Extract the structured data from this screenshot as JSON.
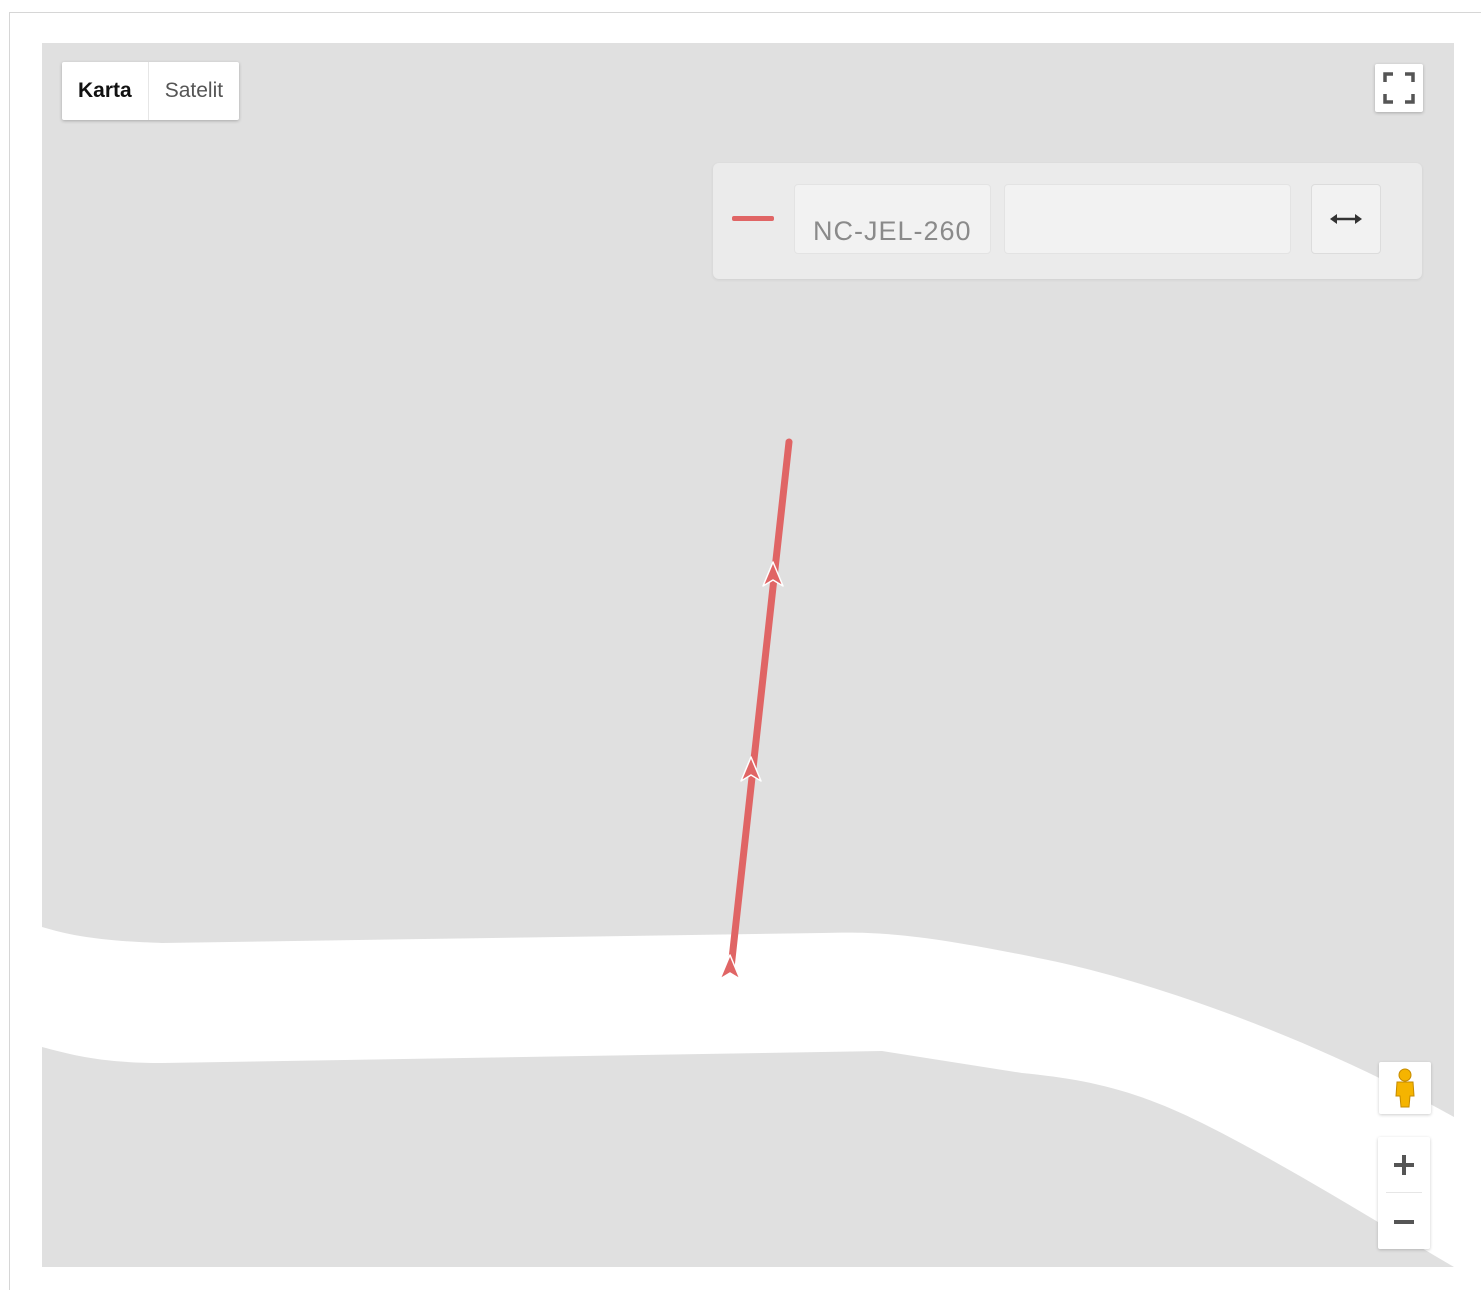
{
  "map_type": {
    "options": [
      "Karta",
      "Satelit"
    ],
    "selected": "Karta"
  },
  "route": {
    "color": "#e06565",
    "name": "NC-JEL-260",
    "second_field_value": ""
  },
  "icons": {
    "fullscreen": "fullscreen-icon",
    "swap": "swap-horizontal-icon",
    "street_view": "pegman-icon",
    "zoom_in": "plus-icon",
    "zoom_out": "minus-icon"
  },
  "colors": {
    "map_background": "#e0e0e0",
    "road": "#ffffff",
    "route_line": "#e06565"
  }
}
